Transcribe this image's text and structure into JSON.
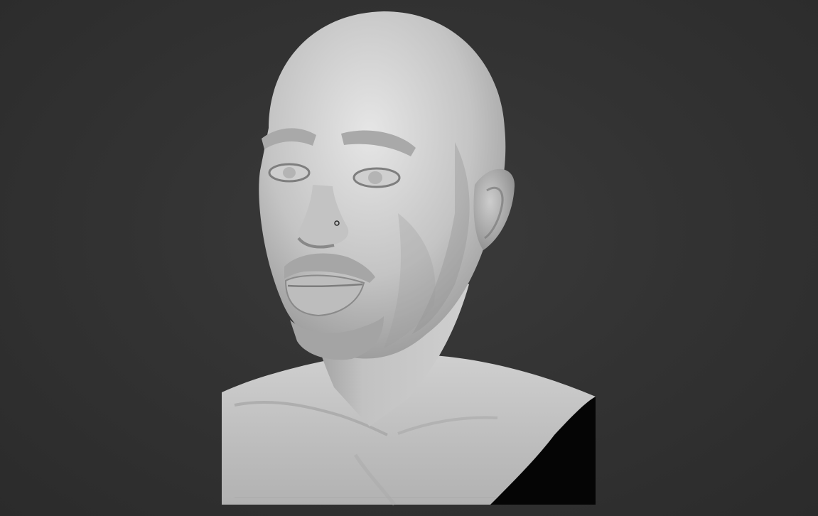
{
  "viewport": {
    "background_color": "#333333",
    "model_color": "#c9c9c9",
    "shadow_color": "#050505",
    "subject": "sculpt-bust"
  }
}
